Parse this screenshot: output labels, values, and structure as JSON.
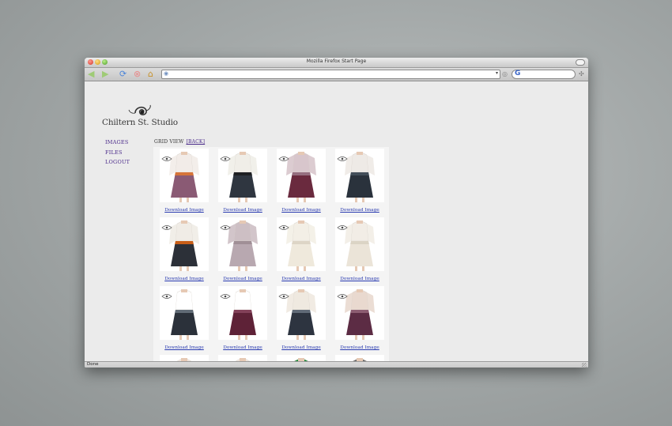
{
  "window": {
    "title": "Mozilla Firefox Start Page"
  },
  "toolbar": {
    "icons": [
      "back-arrow-icon",
      "forward-arrow-icon",
      "reload-icon",
      "stop-icon",
      "home-icon"
    ],
    "url": "",
    "search": ""
  },
  "site": {
    "logo_text": "Chiltern St. Studio",
    "nav": [
      "IMAGES",
      "FILES",
      "LOGOUT"
    ],
    "grid_title": "GRID VIEW",
    "back_label": "[BACK]"
  },
  "grid": {
    "download_label": "Download Image",
    "items": [
      {
        "top": "#f2ece8",
        "bottom": "#8a5a74",
        "accent": "#e87a2a"
      },
      {
        "top": "#f0eee8",
        "bottom": "#2f3640",
        "accent": "#1c1c1c"
      },
      {
        "top": "#d8c6cc",
        "bottom": "#6a2a3e",
        "accent": "#a08090"
      },
      {
        "top": "#eeeae6",
        "bottom": "#2a323c",
        "accent": "#4a5560"
      },
      {
        "top": "#f0ece6",
        "bottom": "#2c3038",
        "accent": "#f06a10"
      },
      {
        "top": "#cdbfc4",
        "bottom": "#b8a8b0",
        "accent": "#9a8890"
      },
      {
        "top": "#f3efe6",
        "bottom": "#efe9dc",
        "accent": "#d8d0c0"
      },
      {
        "top": "#f2ede6",
        "bottom": "#ebe4d8",
        "accent": "#d7cfc0"
      },
      {
        "top": "#ffffff",
        "bottom": "#2b313a",
        "accent": "#6f7a86"
      },
      {
        "top": "#ffffff",
        "bottom": "#5e2237",
        "accent": "#8c4a62"
      },
      {
        "top": "#efe9e0",
        "bottom": "#2d3440",
        "accent": "#6d7884"
      },
      {
        "top": "#e9d9cf",
        "bottom": "#5c2c44",
        "accent": "#9a6a7e"
      },
      {
        "top": "#f1e6dc",
        "bottom": "#ffffff",
        "accent": "#e4cbb8"
      },
      {
        "top": "#f1e6dc",
        "bottom": "#ffffff",
        "accent": "#e8d6c6"
      },
      {
        "top": "#1e8a3a",
        "bottom": "#ffffff",
        "accent": "#29a046"
      },
      {
        "top": "#6a6a6a",
        "bottom": "#ffffff",
        "accent": "#8a8a8a"
      }
    ]
  },
  "statusbar": {
    "text": "Done"
  }
}
